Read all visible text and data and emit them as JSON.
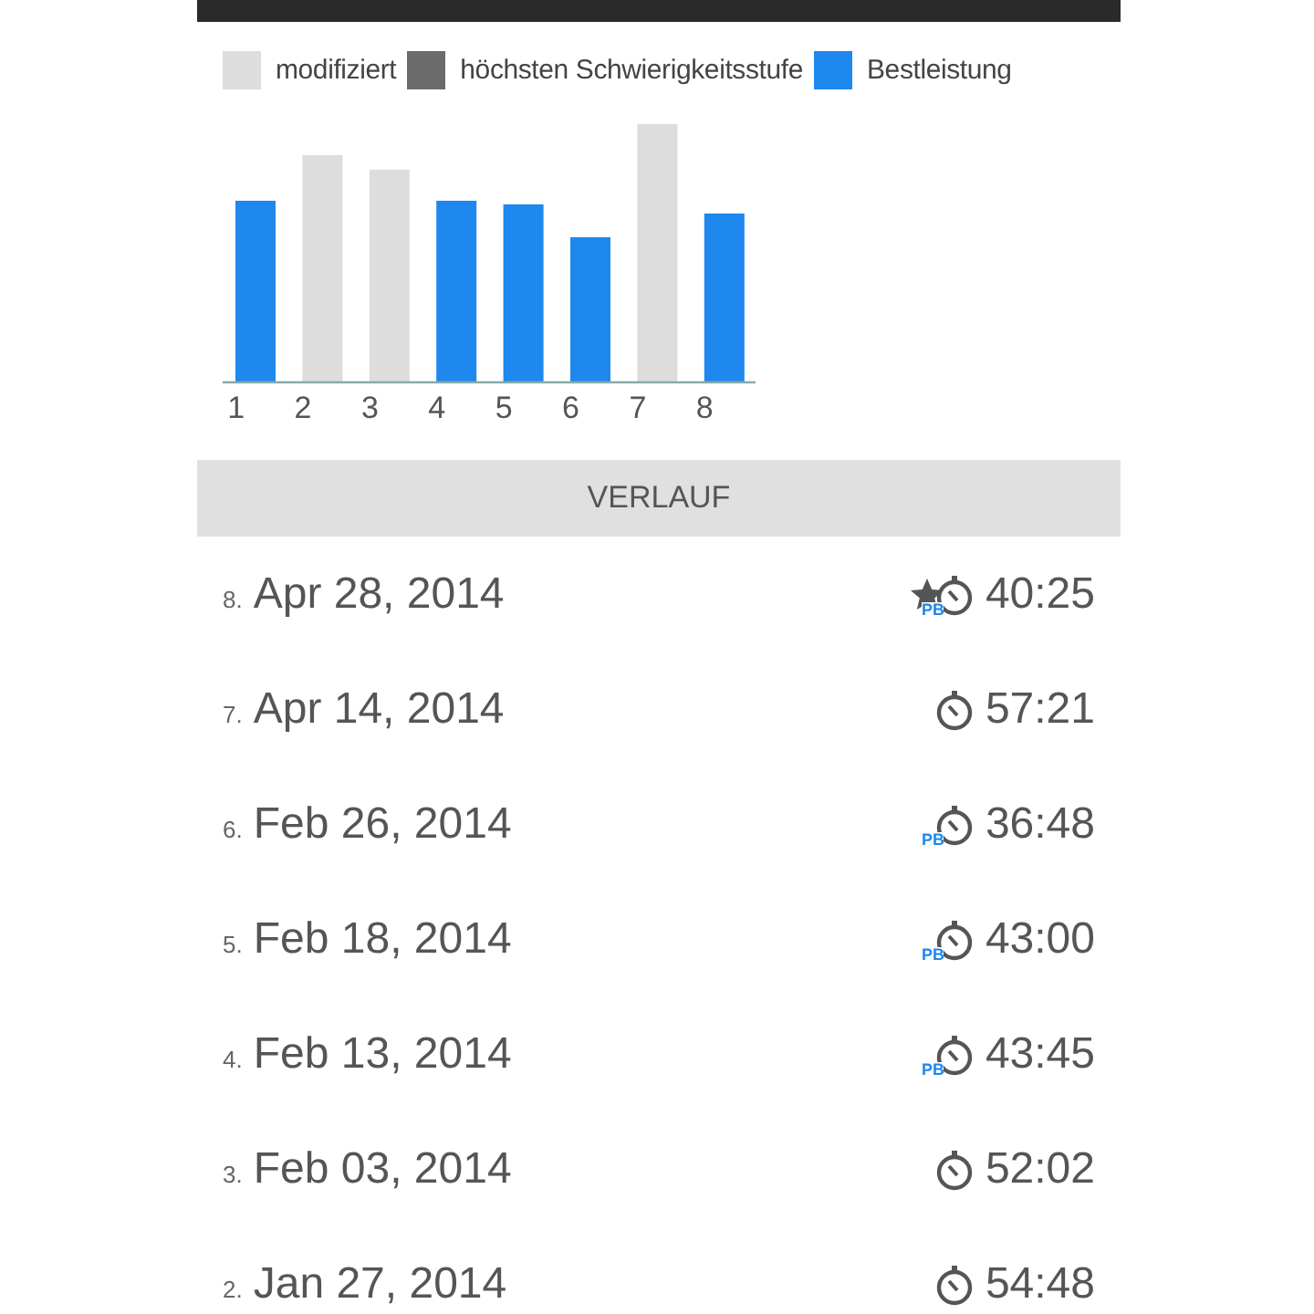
{
  "legend": [
    {
      "label": "modifiziert",
      "color": "#dddddd"
    },
    {
      "label": "höchsten Schwierigkeitsstufe",
      "color": "#6b6b6b"
    },
    {
      "label": "Bestleistung",
      "color": "#1e88ee"
    }
  ],
  "chart_bars": [
    {
      "label": "1",
      "kind": "best"
    },
    {
      "label": "2",
      "kind": "modified"
    },
    {
      "label": "3",
      "kind": "modified"
    },
    {
      "label": "4",
      "kind": "best"
    },
    {
      "label": "5",
      "kind": "best"
    },
    {
      "label": "6",
      "kind": "best"
    },
    {
      "label": "7",
      "kind": "modified"
    },
    {
      "label": "8",
      "kind": "best"
    }
  ],
  "section_header": "VERLAUF",
  "history": [
    {
      "index": "8.",
      "date": "Apr 28, 2014",
      "starred": true,
      "badge": "PB",
      "time": "40:25"
    },
    {
      "index": "7.",
      "date": "Apr 14, 2014",
      "starred": false,
      "time": "57:21"
    },
    {
      "index": "6.",
      "date": "Feb 26, 2014",
      "starred": false,
      "badge": "PB",
      "time": "36:48"
    },
    {
      "index": "5.",
      "date": "Feb 18, 2014",
      "starred": false,
      "badge": "PB",
      "time": "43:00"
    },
    {
      "index": "4.",
      "date": "Feb 13, 2014",
      "starred": false,
      "badge": "PB",
      "time": "43:45"
    },
    {
      "index": "3.",
      "date": "Feb 03, 2014",
      "starred": false,
      "time": "52:02"
    },
    {
      "index": "2.",
      "date": "Jan 27, 2014",
      "starred": false,
      "time": "54:48"
    }
  ]
}
